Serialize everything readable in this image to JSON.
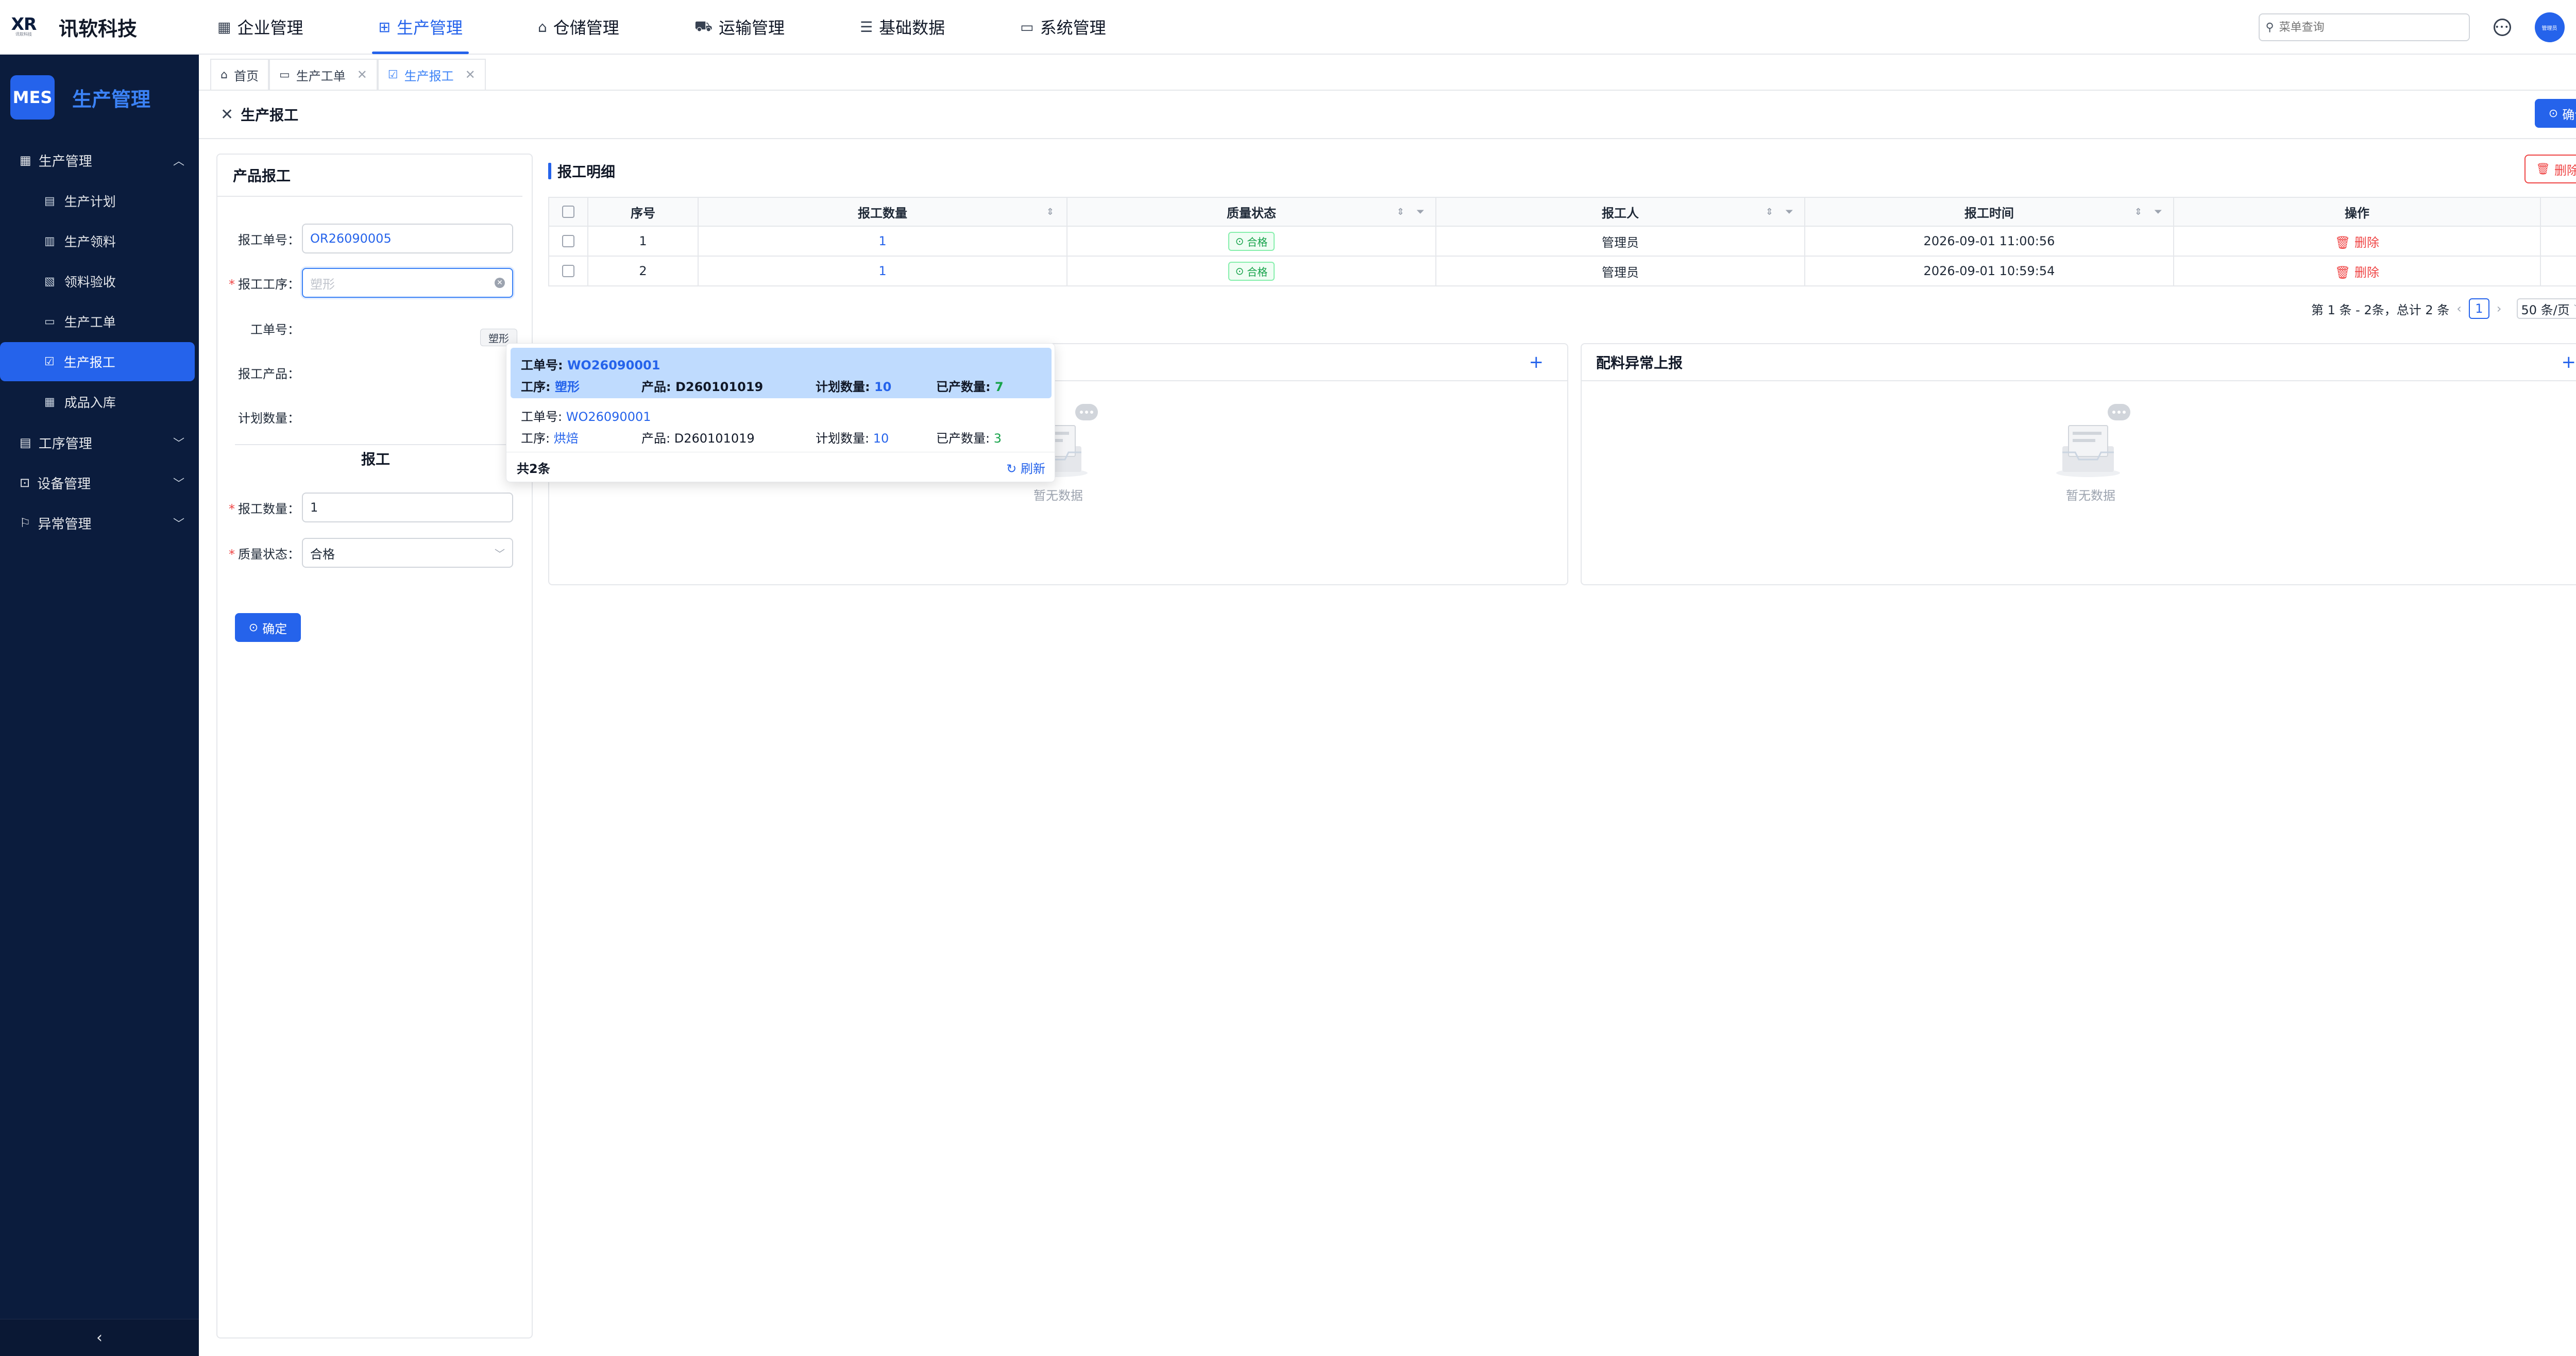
{
  "brand": {
    "mark": "XR",
    "mark_sub": "讯软科技",
    "name": "讯软科技"
  },
  "topnav": [
    {
      "label": "企业管理",
      "icon": "grid-icon",
      "glyph": "▦"
    },
    {
      "label": "生产管理",
      "icon": "apps-icon",
      "glyph": "⊞"
    },
    {
      "label": "仓储管理",
      "icon": "warehouse-icon",
      "glyph": "⌂"
    },
    {
      "label": "运输管理",
      "icon": "truck-icon",
      "glyph": "⛟"
    },
    {
      "label": "基础数据",
      "icon": "database-icon",
      "glyph": "☰"
    },
    {
      "label": "系统管理",
      "icon": "monitor-icon",
      "glyph": "▭"
    }
  ],
  "topnav_active": 1,
  "search": {
    "placeholder": "菜单查询"
  },
  "user": {
    "avatar_text": "管理员"
  },
  "sidebar": {
    "badge": "MES",
    "title": "生产管理",
    "group_main": "生产管理",
    "items": [
      {
        "label": "生产计划",
        "glyph": "▤"
      },
      {
        "label": "生产领料",
        "glyph": "▥"
      },
      {
        "label": "领料验收",
        "glyph": "▧"
      },
      {
        "label": "生产工单",
        "glyph": "▭"
      },
      {
        "label": "生产报工",
        "glyph": "☑"
      },
      {
        "label": "成品入库",
        "glyph": "▦"
      }
    ],
    "active_index": 4,
    "groups_other": [
      {
        "label": "工序管理",
        "glyph": "▤"
      },
      {
        "label": "设备管理",
        "glyph": "⊡"
      },
      {
        "label": "异常管理",
        "glyph": "⚐"
      }
    ]
  },
  "tabs": [
    {
      "label": "首页",
      "glyph": "⌂",
      "closable": false
    },
    {
      "label": "生产工单",
      "glyph": "▭",
      "closable": true
    },
    {
      "label": "生产报工",
      "glyph": "☑",
      "closable": true
    }
  ],
  "page": {
    "title": "生产报工",
    "confirm": "确认"
  },
  "form": {
    "title": "产品报工",
    "order_label": "报工单号：",
    "order_value": "OR26090005",
    "process_label": "报工工序：",
    "process_placeholder": "塑形",
    "process_tooltip": "塑形",
    "workorder_label": "工单号：",
    "product_label": "报工产品：",
    "planned_label": "计划数量：",
    "section": "报工",
    "qty_label": "报工数量：",
    "qty_value": "1",
    "quality_label": "质量状态：",
    "quality_value": "合格",
    "submit": "确定"
  },
  "dropdown": {
    "options": [
      {
        "wo_label": "工单号: ",
        "wo": "WO26090001",
        "proc_label": "工序: ",
        "proc": "塑形",
        "product_label": "产品: ",
        "product": "D260101019",
        "plan_label": "计划数量: ",
        "plan": "10",
        "done_label": "已产数量: ",
        "done": "7"
      },
      {
        "wo_label": "工单号: ",
        "wo": "WO26090001",
        "proc_label": "工序: ",
        "proc": "烘焙",
        "product_label": "产品: ",
        "product": "D260101019",
        "plan_label": "计划数量: ",
        "plan": "10",
        "done_label": "已产数量: ",
        "done": "3"
      }
    ],
    "count": "共2条",
    "refresh": "刷新"
  },
  "detail": {
    "title": "报工明细",
    "delete": "删除",
    "columns": [
      "序号",
      "报工数量",
      "质量状态",
      "报工人",
      "报工时间",
      "操作"
    ],
    "rows": [
      {
        "no": "1",
        "qty": "1",
        "quality": "合格",
        "person": "管理员",
        "time": "2026-09-01 11:00:56",
        "action": "删除"
      },
      {
        "no": "2",
        "qty": "1",
        "quality": "合格",
        "person": "管理员",
        "time": "2026-09-01 10:59:54",
        "action": "删除"
      }
    ]
  },
  "pager": {
    "summary": "第 1 条 - 2条，总计 2 条",
    "page": "1",
    "size": "50 条/页"
  },
  "cards": [
    {
      "title": "",
      "empty": "暂无数据"
    },
    {
      "title": "配料异常上报",
      "empty": "暂无数据"
    }
  ],
  "colors": {
    "primary": "#2563eb",
    "sidebar": "#0b1c3d",
    "danger": "#ef4444",
    "success": "#16a34a"
  }
}
